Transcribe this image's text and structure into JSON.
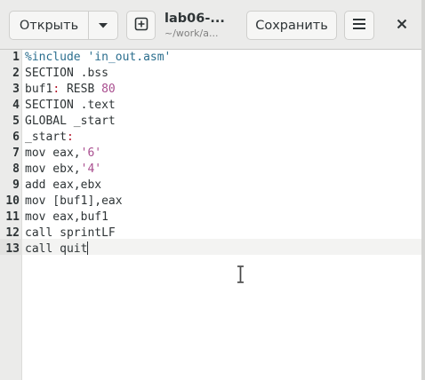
{
  "header": {
    "open_label": "Открыть",
    "title": "lab06-...",
    "subtitle": "~/work/a...",
    "save_label": "Сохранить"
  },
  "icons": {
    "open_menu": "chevron-down-icon",
    "new_tab": "new-document-icon",
    "main_menu": "hamburger-menu-icon",
    "close": "close-icon",
    "pointer": "text-cursor-ibeam-icon"
  },
  "editor": {
    "line_numbers": [
      "1",
      "2",
      "3",
      "4",
      "5",
      "6",
      "7",
      "8",
      "9",
      "10",
      "11",
      "12",
      "13"
    ],
    "current_line": 13,
    "lines": [
      [
        {
          "t": "%include ",
          "c": "pre"
        },
        {
          "t": "'in_out.asm'",
          "c": "pre"
        }
      ],
      [
        {
          "t": "SECTION .bss",
          "c": "plain"
        }
      ],
      [
        {
          "t": "buf1",
          "c": "plain"
        },
        {
          "t": ":",
          "c": "label"
        },
        {
          "t": " RESB ",
          "c": "plain"
        },
        {
          "t": "80",
          "c": "num"
        }
      ],
      [
        {
          "t": "SECTION .text",
          "c": "plain"
        }
      ],
      [
        {
          "t": "GLOBAL _start",
          "c": "plain"
        }
      ],
      [
        {
          "t": "_start",
          "c": "plain"
        },
        {
          "t": ":",
          "c": "label"
        }
      ],
      [
        {
          "t": "mov eax,",
          "c": "plain"
        },
        {
          "t": "'6'",
          "c": "str"
        }
      ],
      [
        {
          "t": "mov ebx,",
          "c": "plain"
        },
        {
          "t": "'4'",
          "c": "str"
        }
      ],
      [
        {
          "t": "add eax,ebx",
          "c": "plain"
        }
      ],
      [
        {
          "t": "mov [buf1],eax",
          "c": "plain"
        }
      ],
      [
        {
          "t": "mov eax,buf1",
          "c": "plain"
        }
      ],
      [
        {
          "t": "call sprintLF",
          "c": "plain"
        }
      ],
      [
        {
          "t": "call quit",
          "c": "plain"
        }
      ]
    ]
  },
  "colors": {
    "preprocessor": "#2b6e8e",
    "string": "#a94e8f",
    "label_colon": "#b3162b",
    "header_bg": "#ebebea"
  }
}
